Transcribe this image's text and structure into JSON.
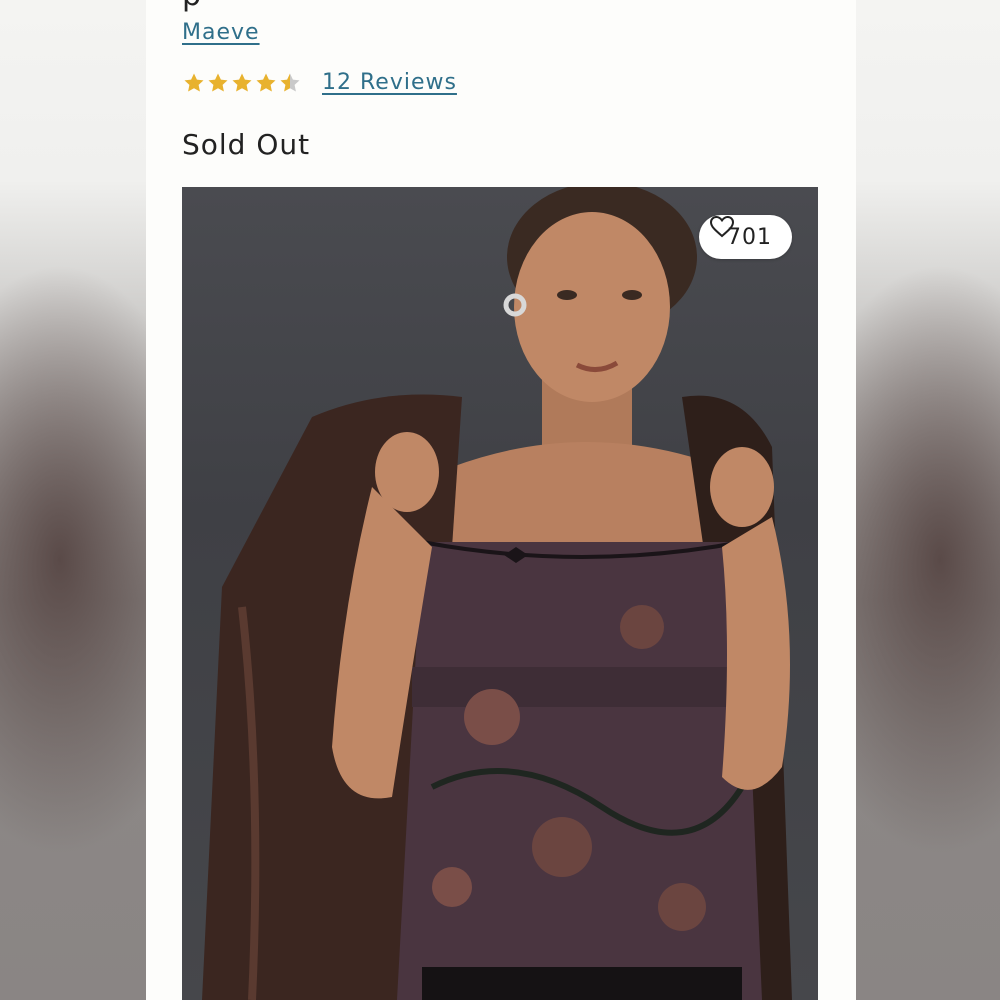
{
  "product": {
    "title_partial": "p",
    "brand": "Maeve",
    "rating": 4.5,
    "reviews_label": "12 Reviews",
    "availability": "Sold Out",
    "like_count": "701"
  },
  "colors": {
    "link": "#2f6f8a",
    "star": "#e8b22e",
    "star_empty": "#c9c9c9",
    "text": "#222222",
    "background": "#fdfdfb"
  },
  "icons": {
    "rating": "star-icon",
    "favorite": "heart-outline-icon"
  }
}
